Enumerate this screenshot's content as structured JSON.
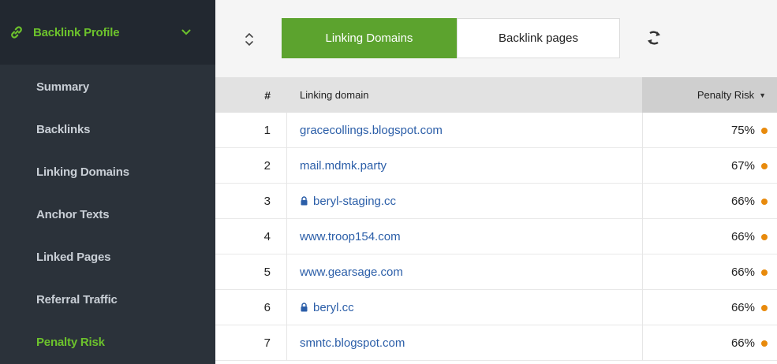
{
  "sidebar": {
    "header": {
      "title": "Backlink Profile",
      "icon": "link-icon",
      "accent": "#6cc22c"
    },
    "items": [
      {
        "label": "Summary",
        "active": false
      },
      {
        "label": "Backlinks",
        "active": false
      },
      {
        "label": "Linking Domains",
        "active": false
      },
      {
        "label": "Anchor Texts",
        "active": false
      },
      {
        "label": "Linked Pages",
        "active": false
      },
      {
        "label": "Referral Traffic",
        "active": false
      },
      {
        "label": "Penalty Risk",
        "active": true
      }
    ]
  },
  "toolbar": {
    "tabs": [
      {
        "label": "Linking Domains",
        "active": true
      },
      {
        "label": "Backlink pages",
        "active": false
      }
    ]
  },
  "table": {
    "headers": {
      "num": "#",
      "domain": "Linking domain",
      "risk": "Penalty Risk"
    },
    "rows": [
      {
        "num": "1",
        "domain": "gracecollings.blogspot.com",
        "secure": false,
        "risk": "75%"
      },
      {
        "num": "2",
        "domain": "mail.mdmk.party",
        "secure": false,
        "risk": "67%"
      },
      {
        "num": "3",
        "domain": "beryl-staging.cc",
        "secure": true,
        "risk": "66%"
      },
      {
        "num": "4",
        "domain": "www.troop154.com",
        "secure": false,
        "risk": "66%"
      },
      {
        "num": "5",
        "domain": "www.gearsage.com",
        "secure": false,
        "risk": "66%"
      },
      {
        "num": "6",
        "domain": "beryl.cc",
        "secure": true,
        "risk": "66%"
      },
      {
        "num": "7",
        "domain": "smntc.blogspot.com",
        "secure": false,
        "risk": "66%"
      }
    ],
    "risk_dot_color": "#e88a0c"
  }
}
